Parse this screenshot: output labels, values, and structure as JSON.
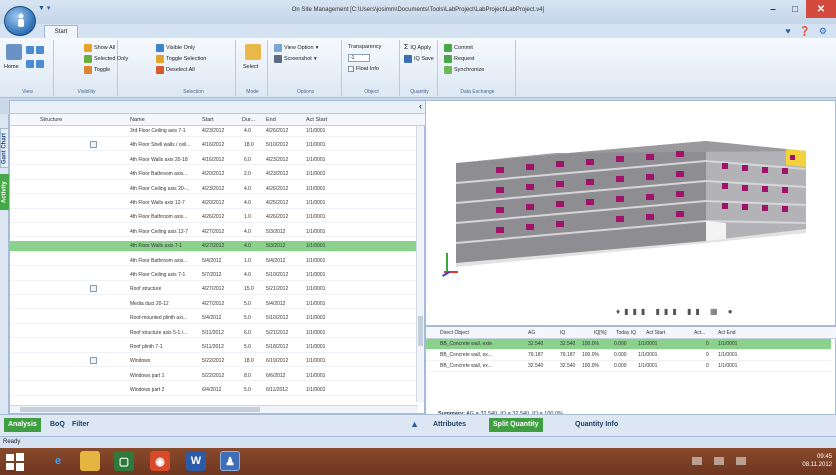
{
  "window": {
    "title": "On Site Management [C:\\Users\\josimm\\Documents\\Tools\\LabProject\\LabProject\\LabProject.v4]",
    "tab": "Start"
  },
  "ribbon": {
    "groups": {
      "view": "View",
      "visibility": "Visibility",
      "selection": "Selection",
      "mode": "Mode",
      "options": "Options",
      "object": "Object",
      "quantity": "Quantity",
      "data_exchange": "Data Exchange"
    },
    "home": "Home",
    "show_all": "Show All",
    "selected_only": "Selected Only",
    "toggle": "Toggle",
    "visible_only": "Visible Only",
    "toggle_selection": "Toggle Selection",
    "deselect_all": "Deselect All",
    "select": "Select",
    "view_option": "View Option",
    "screenshot": "Screenshot",
    "transparency": "Transparency",
    "transparency_value": "-1",
    "float_info": "Float Info",
    "iq_apply": "IQ Apply",
    "iq_save": "IQ Save",
    "commit": "Commit",
    "request": "Request",
    "synchronize": "Synchronize"
  },
  "side_tabs": {
    "gantt": "Gant Chart",
    "activity": "Activity"
  },
  "grid": {
    "headers": {
      "structure": "Structure",
      "name": "Name",
      "start": "Start",
      "duration": "Dur...",
      "end": "End",
      "act_start": "Act Start"
    },
    "rows": [
      {
        "name": "3rd Floor Ceiling axis 7-1",
        "start": "4/23/2012",
        "dur": "4.0",
        "end": "4/26/2012",
        "act": "1/1/0001",
        "tree": false
      },
      {
        "name": "4th Floor Shell walls / ceil...",
        "start": "4/16/2012",
        "dur": "18.0",
        "end": "5/10/2012",
        "act": "1/1/0001",
        "tree": true
      },
      {
        "name": "4th Floor Walls axis 20-18",
        "start": "4/16/2012",
        "dur": "6.0",
        "end": "4/23/2012",
        "act": "1/1/0001",
        "tree": false
      },
      {
        "name": "4th Floor Bathroom axis...",
        "start": "4/20/2012",
        "dur": "2.0",
        "end": "4/23/2012",
        "act": "1/1/0001",
        "tree": false
      },
      {
        "name": "4th Floor Ceiling axis 20-...",
        "start": "4/23/2012",
        "dur": "4.0",
        "end": "4/26/2012",
        "act": "1/1/0001",
        "tree": false
      },
      {
        "name": "4th Floor Walls axis 12-7",
        "start": "4/20/2012",
        "dur": "4.0",
        "end": "4/25/2012",
        "act": "1/1/0001",
        "tree": false
      },
      {
        "name": "4th Floor Bathroom axis...",
        "start": "4/26/2012",
        "dur": "1.0",
        "end": "4/26/2012",
        "act": "1/1/0001",
        "tree": false
      },
      {
        "name": "4th Floor Ceiling axis 12-7",
        "start": "4/27/2012",
        "dur": "4.0",
        "end": "5/3/2012",
        "act": "1/1/0001",
        "tree": false
      },
      {
        "name": "4th Floor Walls axis 7-1",
        "start": "4/27/2012",
        "dur": "4.0",
        "end": "5/3/2012",
        "act": "1/1/0001",
        "tree": false,
        "selected": true
      },
      {
        "name": "4th Floor Bathroom axis...",
        "start": "5/4/2012",
        "dur": "1.0",
        "end": "5/4/2012",
        "act": "1/1/0001",
        "tree": false
      },
      {
        "name": "4th Floor Ceiling axis 7-1",
        "start": "5/7/2012",
        "dur": "4.0",
        "end": "5/10/2012",
        "act": "1/1/0001",
        "tree": false
      },
      {
        "name": "Roof structure",
        "start": "4/27/2012",
        "dur": "15.0",
        "end": "5/21/2012",
        "act": "1/1/0001",
        "tree": true
      },
      {
        "name": "Media duct 20-12",
        "start": "4/27/2012",
        "dur": "5.0",
        "end": "5/4/2012",
        "act": "1/1/0001",
        "tree": false
      },
      {
        "name": "Roof-mounted plinth axi...",
        "start": "5/4/2012",
        "dur": "5.0",
        "end": "5/10/2012",
        "act": "1/1/0001",
        "tree": false
      },
      {
        "name": "Roof structure axis 5-1 /...",
        "start": "5/11/2012",
        "dur": "6.0",
        "end": "5/21/2012",
        "act": "1/1/0001",
        "tree": false
      },
      {
        "name": "Roof plinth 7-1",
        "start": "5/11/2012",
        "dur": "5.0",
        "end": "5/18/2012",
        "act": "1/1/0001",
        "tree": false
      },
      {
        "name": "Windows",
        "start": "5/22/2012",
        "dur": "18.0",
        "end": "6/19/2012",
        "act": "1/1/0001",
        "tree": true
      },
      {
        "name": "Windows part 1",
        "start": "5/22/2012",
        "dur": "8.0",
        "end": "6/6/2012",
        "act": "1/1/0001",
        "tree": false
      },
      {
        "name": "Windows part 2",
        "start": "6/4/2012",
        "dur": "5.0",
        "end": "6/11/2012",
        "act": "1/1/0001",
        "tree": false
      }
    ]
  },
  "bottom_tabs_left": {
    "analysis": "Analysis",
    "boq": "BoQ",
    "filter": "Filter"
  },
  "qty": {
    "headers": {
      "object": "Direct Object",
      "ag": "AG",
      "iq": "IQ",
      "iq_pct": "IQ[%]",
      "today": "Today IQ",
      "act_start": "Act Start",
      "act": "Act...",
      "act_end": "Act End"
    },
    "rows": [
      {
        "object": "BB_Concrete wall, exte",
        "ag": "32.540",
        "iq": "32.540",
        "pct": "100.0%",
        "today": "0.000",
        "start": "1/1/0001",
        "act": "0",
        "end": "1/1/0001",
        "selected": true
      },
      {
        "object": "BB_Concrete wall, ex...",
        "ag": "79.187",
        "iq": "79.187",
        "pct": "100.0%",
        "today": "0.000",
        "start": "1/1/0001",
        "act": "0",
        "end": "1/1/0001"
      },
      {
        "object": "BB_Concrete wall, ex...",
        "ag": "32.540",
        "iq": "32.540",
        "pct": "100.0%",
        "today": "0.000",
        "start": "1/1/0001",
        "act": "0",
        "end": "1/1/0001"
      }
    ],
    "summary_label": "Summary:",
    "summary_text": "AG = 32.540, IQ = 32.540, IQ = 100.0%"
  },
  "bottom_tabs_right": {
    "attributes": "Attributes",
    "split": "Split Quantity",
    "info": "Quantity Info"
  },
  "status": "Ready",
  "tray": {
    "time": "09:45",
    "date": "08.11.2012"
  }
}
